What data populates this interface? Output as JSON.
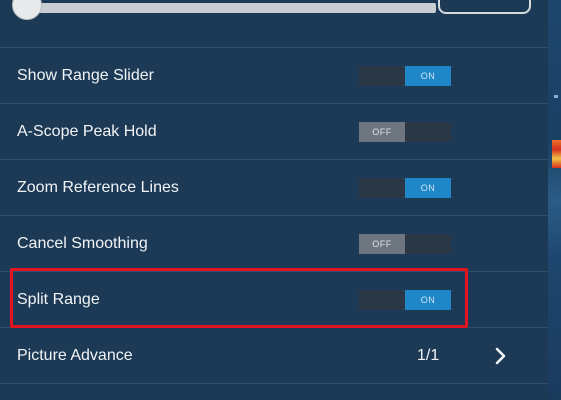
{
  "settings": {
    "rows": [
      {
        "label": "Show Range Slider",
        "toggle": "ON"
      },
      {
        "label": "A-Scope Peak Hold",
        "toggle": "OFF"
      },
      {
        "label": "Zoom Reference Lines",
        "toggle": "ON"
      },
      {
        "label": "Cancel Smoothing",
        "toggle": "OFF"
      },
      {
        "label": "Split Range",
        "toggle": "ON"
      },
      {
        "label": "Picture Advance",
        "value": "1/1"
      }
    ]
  },
  "icons": {
    "picture_advance_chevron": "chevron-right-icon"
  },
  "colors": {
    "panel_bg": "#1c3a56",
    "toggle_on": "#1f86c7",
    "toggle_off": "#6d767f",
    "highlight": "#e2141f"
  }
}
